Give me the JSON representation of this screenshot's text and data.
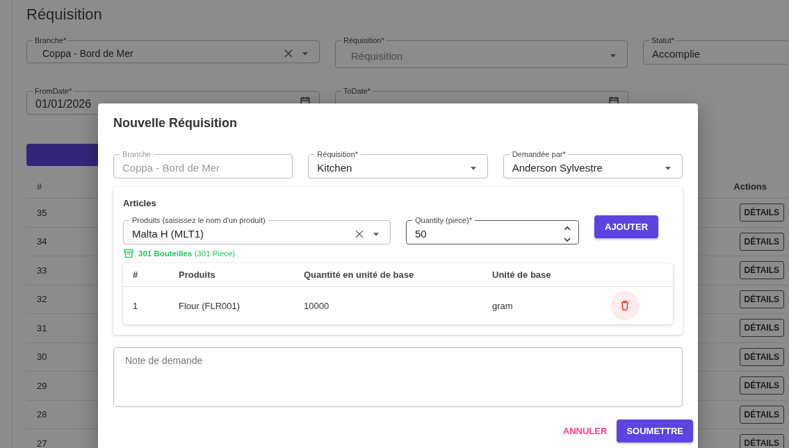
{
  "page": {
    "title": "Réquisition",
    "filters": [
      {
        "kind": "select",
        "label": "Branche*",
        "value": "Coppa - Bord de Mer",
        "clearable": true
      },
      {
        "kind": "select",
        "label": "Réquisition*",
        "placeholder": "Réquisition",
        "clearable": false
      },
      {
        "kind": "text",
        "label": "Statut*",
        "value": "Accomplie"
      },
      {
        "kind": "date",
        "label": "FromDate*",
        "value": "01/01/2026"
      },
      {
        "kind": "date",
        "label": "ToDate*"
      }
    ],
    "table": {
      "columns": [
        "#",
        "Actions"
      ],
      "rows": [
        {
          "number": "35",
          "action": "DÉTAILS"
        },
        {
          "number": "34",
          "action": "DÉTAILS"
        },
        {
          "number": "33",
          "action": "DÉTAILS"
        },
        {
          "number": "32",
          "action": "DÉTAILS"
        },
        {
          "number": "31",
          "action": "DÉTAILS"
        },
        {
          "number": "30",
          "action": "DÉTAILS"
        },
        {
          "number": "29",
          "action": "DÉTAILS"
        },
        {
          "number": "28",
          "action": "DÉTAILS"
        },
        {
          "number": "27",
          "action": "DÉTAILS"
        }
      ]
    }
  },
  "dialog": {
    "title": "Nouvelle Réquisition",
    "fields": [
      {
        "kind": "text",
        "label": "Branche",
        "value": "Coppa - Bord de Mer",
        "disabled": true
      },
      {
        "kind": "select",
        "label": "Réquisition*",
        "value": "Kitchen",
        "disabled": false
      },
      {
        "kind": "select",
        "label": "Demandée par*",
        "value": "Anderson Sylvestre",
        "disabled": false
      }
    ],
    "articles": {
      "title": "Articles",
      "product_field": {
        "label": "Produits (saisissez le nom d'un produit)",
        "value": "Malta H (MLT1)",
        "clearable": true
      },
      "quantity_field": {
        "label": "Quantity (piece)*",
        "value": "50"
      },
      "add_button": "AJOUTER",
      "stock": {
        "main": "301 Bouteilles",
        "detail": "(301 Piece)"
      },
      "table": {
        "columns": [
          "#",
          "Produits",
          "Quantité en unité de base",
          "Unité de base"
        ],
        "rows": [
          {
            "cells": [
              "1",
              "Flour (FLR001)",
              "10000",
              "gram"
            ]
          }
        ]
      }
    },
    "note": {
      "placeholder": "Note de demande"
    },
    "buttons": [
      {
        "kind": "text",
        "label": "ANNULER"
      },
      {
        "kind": "primary",
        "label": "SOUMETTRE"
      }
    ]
  }
}
